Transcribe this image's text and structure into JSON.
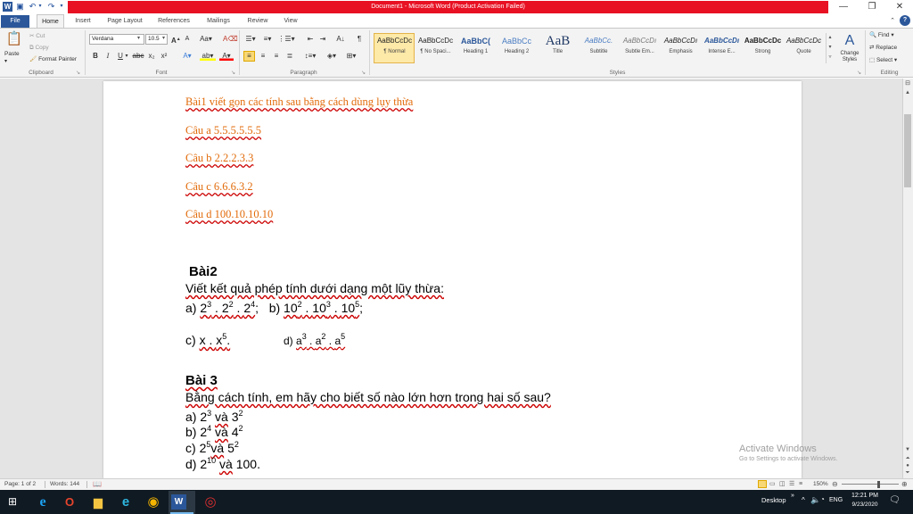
{
  "window": {
    "title": "Document1 - Microsoft Word (Product Activation Failed)",
    "help": "?"
  },
  "tabs": [
    "File",
    "Home",
    "Insert",
    "Page Layout",
    "References",
    "Mailings",
    "Review",
    "View"
  ],
  "ribbon": {
    "clipboard": {
      "paste": "Paste",
      "cut": "Cut",
      "copy": "Copy",
      "format_painter": "Format Painter",
      "label": "Clipboard"
    },
    "font": {
      "name": "Verdana",
      "size": "10.5",
      "label": "Font"
    },
    "paragraph": {
      "label": "Paragraph"
    },
    "styles": {
      "label": "Styles",
      "items": [
        {
          "preview": "AaBbCcDc",
          "name": "¶ Normal"
        },
        {
          "preview": "AaBbCcDc",
          "name": "¶ No Spaci..."
        },
        {
          "preview": "AaBbC(",
          "name": "Heading 1"
        },
        {
          "preview": "AaBbCc",
          "name": "Heading 2"
        },
        {
          "preview": "AaB",
          "name": "Title"
        },
        {
          "preview": "AaBbCc.",
          "name": "Subtitle"
        },
        {
          "preview": "AaBbCcDı",
          "name": "Subtle Em..."
        },
        {
          "preview": "AaBbCcDı",
          "name": "Emphasis"
        },
        {
          "preview": "AaBbCcDı",
          "name": "Intense E..."
        },
        {
          "preview": "AaBbCcDc",
          "name": "Strong"
        },
        {
          "preview": "AaBbCcDc",
          "name": "Quote"
        }
      ],
      "change_styles": "Change Styles"
    },
    "editing": {
      "find": "Find",
      "replace": "Replace",
      "select": "Select",
      "label": "Editing"
    }
  },
  "document": {
    "bai1": {
      "title": "Bài1 viết gọn các tính sau bằng cách dùng lụy thừa",
      "items": [
        "Câu a  5.5.5.5.5.5",
        "Câu b  2.2.2.3.3",
        "Câu c  6.6.6.3.2",
        "Câu d  100.10.10.10"
      ]
    },
    "bai2": {
      "title": "Bài2",
      "prompt": "Viết kết quả phép tính dưới dạng một lũy thừa:",
      "a_label": "a)",
      "b_label": "b)",
      "c_label": "c)",
      "d_label": "d)",
      "a_base": "2",
      "a_e1": "3",
      "a_e2": "2",
      "a_e3": "4",
      "b_base": "10",
      "b_e1": "2",
      "b_e2": "3",
      "b_e3": "5",
      "c_x": "x",
      "c_e": "5",
      "d_base": "a",
      "d_e1": "3",
      "d_e2": "2",
      "d_e3": "5"
    },
    "bai3": {
      "title": "Bài 3",
      "prompt": "Bằng cách tính, em hãy cho biết số nào lớn hơn trong hai số sau?",
      "and": "và",
      "rows": [
        {
          "label": "a)",
          "b1": "2",
          "e1": "3",
          "b2": "3",
          "e2": "2"
        },
        {
          "label": "b)",
          "b1": "2",
          "e1": "4",
          "b2": "4",
          "e2": "2"
        },
        {
          "label": "c)",
          "b1": "2",
          "e1": "5",
          "b2": "5",
          "e2": "2"
        },
        {
          "label": "d)",
          "b1": "2",
          "e1": "10",
          "tail": "100."
        }
      ]
    }
  },
  "activation": {
    "line1": "Activate Windows",
    "line2": "Go to Settings to activate Windows."
  },
  "status": {
    "page": "Page: 1 of 2",
    "words": "Words: 144",
    "zoom": "150%"
  },
  "taskbar": {
    "desktop": "Desktop",
    "lang": "ENG",
    "time": "12:21 PM",
    "date": "9/23/2020"
  },
  "colors": {
    "file_tab": "#2b579a",
    "title_bar": "#e81123",
    "doc_orange": "#e26b0a",
    "taskbar": "#101a23"
  }
}
